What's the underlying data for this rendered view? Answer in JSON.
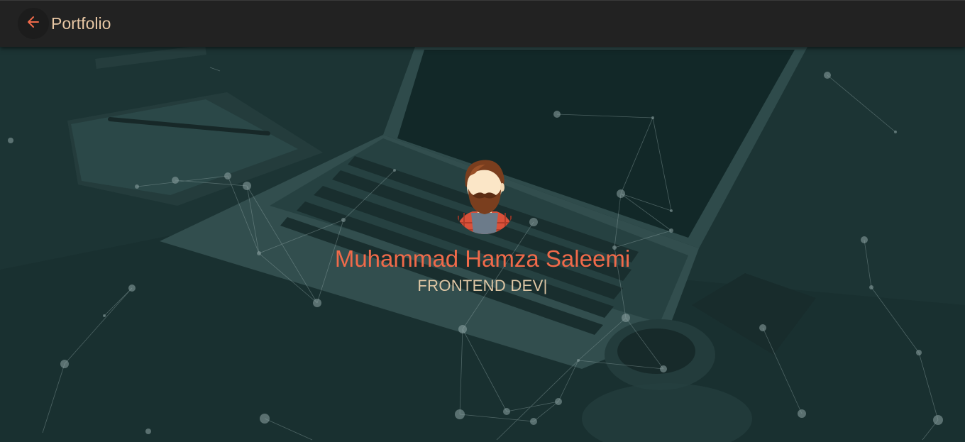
{
  "header": {
    "back_icon": "arrow-left-icon",
    "title": "Portfolio"
  },
  "hero": {
    "name": "Muhammad Hamza Saleemi",
    "role": "FRONTEND DEV|",
    "avatar": "bearded-man-avatar"
  },
  "colors": {
    "topbar": "#222222",
    "accent": "#f06a4a",
    "title_text": "#e8c7a4",
    "overlay": "#1f3434"
  }
}
